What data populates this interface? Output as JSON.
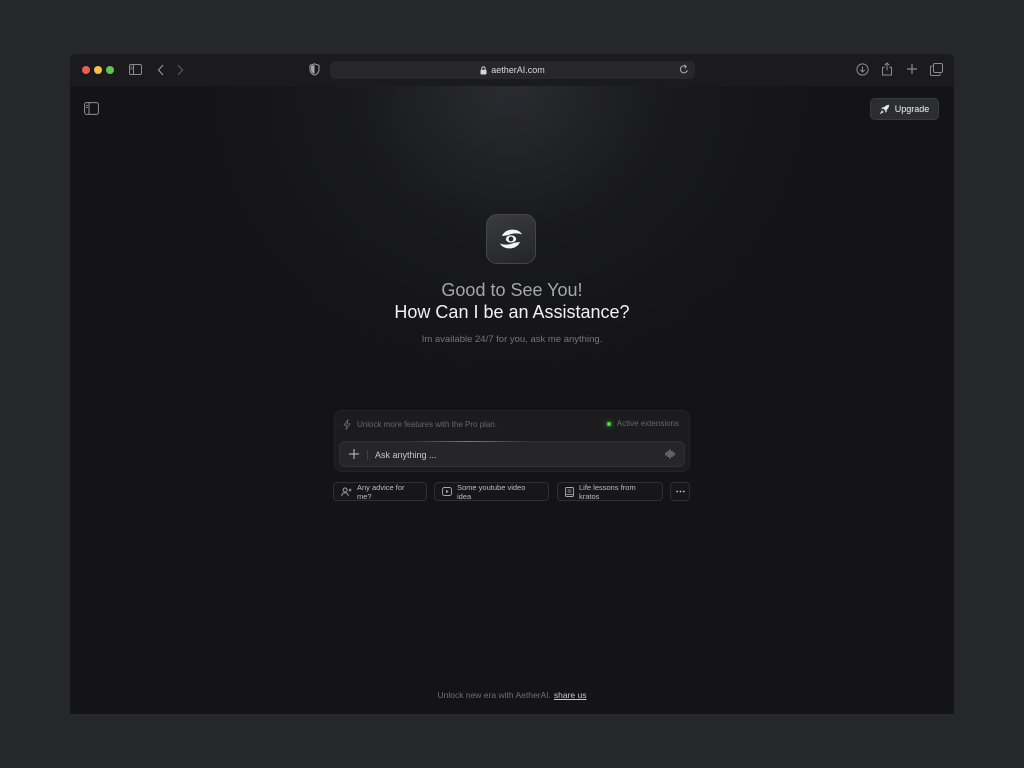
{
  "browser": {
    "url": "aetherAI.com",
    "icons": [
      "sidebar-icon",
      "back-icon",
      "forward-icon",
      "shield-icon",
      "lock-icon",
      "reload-icon",
      "download-icon",
      "share-icon",
      "new-tab-icon",
      "tabs-overview-icon"
    ]
  },
  "header": {
    "upgrade_label": "Upgrade"
  },
  "hero": {
    "greeting": "Good to See You!",
    "headline": "How Can I be an Assistance?",
    "subtext": "Im available 24/7 for you, ask me anything."
  },
  "chat": {
    "pro_notice": "Unlock more features with the Pro plan.",
    "extensions_label": "Active extensions",
    "input_placeholder": "Ask anything ...",
    "status_color": "#52d44a"
  },
  "suggestions": [
    {
      "label": "Any advice for me?",
      "icon": "user-plus-icon"
    },
    {
      "label": "Some youtube video idea",
      "icon": "video-icon"
    },
    {
      "label": "Life lessons from kratos",
      "icon": "book-icon"
    }
  ],
  "footer": {
    "text": "Unlock new era with AetherAI.",
    "link": "share us"
  }
}
